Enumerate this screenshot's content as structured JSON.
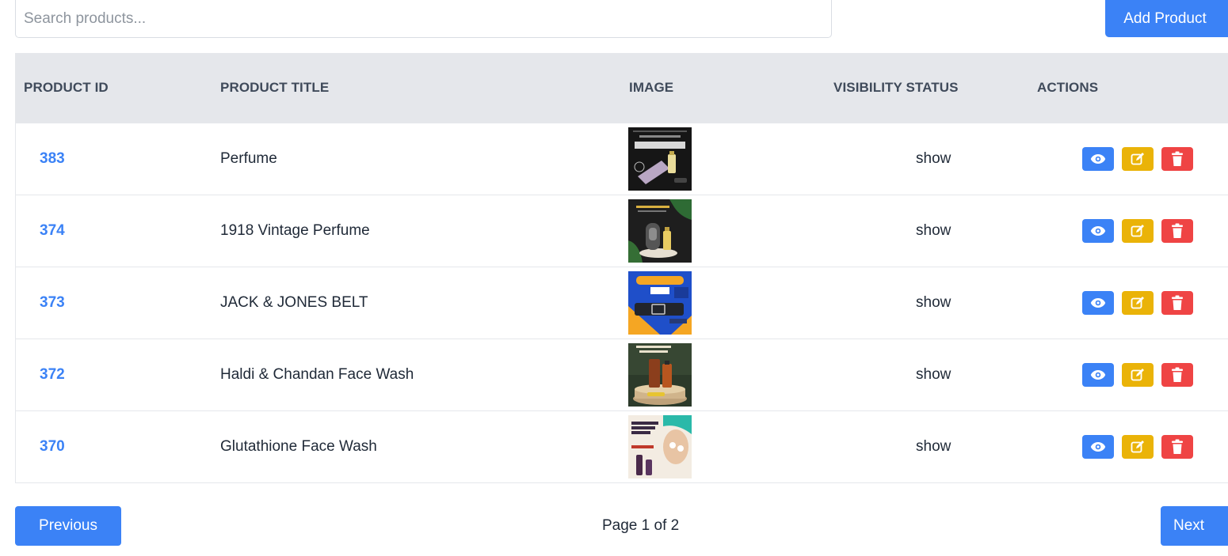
{
  "search": {
    "placeholder": "Search products..."
  },
  "toolbar": {
    "add_label": "Add Product"
  },
  "table": {
    "headers": {
      "id": "PRODUCT ID",
      "title": "PRODUCT TITLE",
      "image": "IMAGE",
      "status": "VISIBILITY STATUS",
      "actions": "ACTIONS"
    },
    "rows": [
      {
        "id": "383",
        "title": "Perfume",
        "status": "show",
        "image_icon": "perfume-product-thumbnail"
      },
      {
        "id": "374",
        "title": "1918 Vintage Perfume",
        "status": "show",
        "image_icon": "vintage-perfume-product-thumbnail"
      },
      {
        "id": "373",
        "title": "JACK & JONES BELT",
        "status": "show",
        "image_icon": "belt-product-thumbnail"
      },
      {
        "id": "372",
        "title": "Haldi & Chandan Face Wash",
        "status": "show",
        "image_icon": "face-wash-product-thumbnail"
      },
      {
        "id": "370",
        "title": "Glutathione Face Wash",
        "status": "show",
        "image_icon": "glutathione-face-wash-product-thumbnail"
      }
    ],
    "action_icons": [
      "eye-icon",
      "edit-icon",
      "trash-icon"
    ]
  },
  "pagination": {
    "previous_label": "Previous",
    "page_text": "Page 1 of 2",
    "next_label": "Next"
  },
  "colors": {
    "primary": "#3b82f6",
    "edit": "#eab308",
    "delete": "#ef4444",
    "header_bg": "#e5e7eb"
  }
}
